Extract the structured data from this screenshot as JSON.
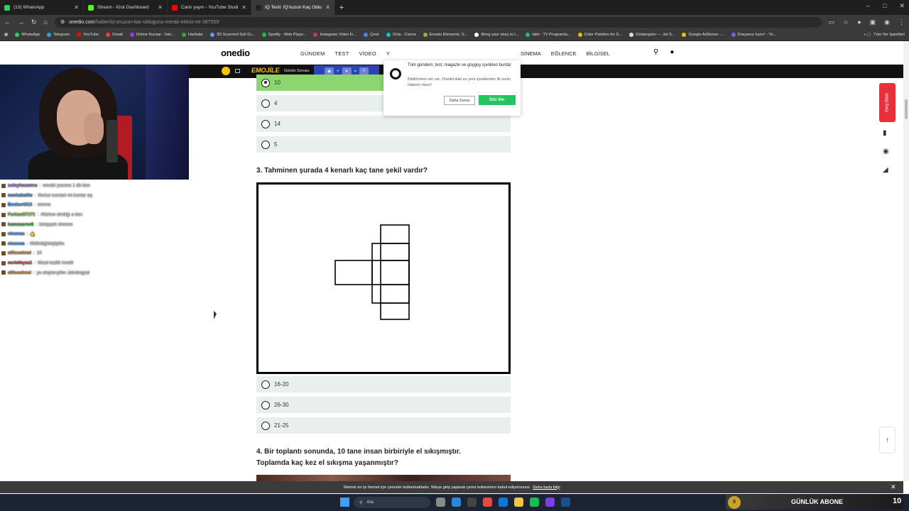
{
  "browser": {
    "tabs": [
      {
        "title": "(13) WhatsApp",
        "color": "#25d366",
        "active": false
      },
      {
        "title": "Stream - Kick Dashboard",
        "color": "#53fc18",
        "active": false
      },
      {
        "title": "Canlı yayın - YouTube Studio",
        "color": "#ff0000",
        "active": false
      },
      {
        "title": "IQ Testi: IQ'nuzun Kaç Olduğu",
        "color": "#222222",
        "active": true
      }
    ],
    "url_host": "onedio.com",
    "url_path": "/haber/iq-unuzun-kac-oldugunu-merak-ettiniz-mi-387559",
    "bookmarks": [
      {
        "label": "WhatsApp",
        "color": "#25d366"
      },
      {
        "label": "Telegram",
        "color": "#2aa4e4"
      },
      {
        "label": "YouTube",
        "color": "#ff0000"
      },
      {
        "label": "Gmail",
        "color": "#ea4335"
      },
      {
        "label": "Online Kursiar - İste...",
        "color": "#a435f0"
      },
      {
        "label": "Haritalar",
        "color": "#34a853"
      },
      {
        "label": "3D Scanned Soil Gr...",
        "color": "#5aa0ff"
      },
      {
        "label": "Spotify - Web Playe...",
        "color": "#1db954"
      },
      {
        "label": "Instagram Video İn...",
        "color": "#c13584"
      },
      {
        "label": "Çevir",
        "color": "#4285f4"
      },
      {
        "label": "Giriş - Canva",
        "color": "#00c4cc"
      },
      {
        "label": "Envato Elements: S...",
        "color": "#82b541"
      },
      {
        "label": "Bring your story to l...",
        "color": "#ffffff"
      },
      {
        "label": "tabii - TV Programla...",
        "color": "#1fb8a0"
      },
      {
        "label": "Color Palettes for D...",
        "color": "#f5b400"
      },
      {
        "label": "Göstergeler — Jet S...",
        "color": "#dddddd"
      },
      {
        "label": "Google AdSense -...",
        "color": "#fbbc04"
      },
      {
        "label": "Dosyanız hazır! - Yo...",
        "color": "#7b5cff"
      }
    ],
    "bookmarks_all": "Tüm Yer İşaretleri"
  },
  "site": {
    "logo": "onedio",
    "nav": [
      "GÜNDEM",
      "TEST",
      "VİDEO",
      "Y"
    ],
    "nav_right": [
      "SİNEMA",
      "EĞLENCE",
      "BİLGİSEL"
    ],
    "emojile": "EMOJİLE",
    "gunun_sorusu": "Günün Sorusu"
  },
  "quiz": {
    "q2_options": [
      {
        "text": "10",
        "selected": true
      },
      {
        "text": "4",
        "selected": false
      },
      {
        "text": "14",
        "selected": false
      },
      {
        "text": "5",
        "selected": false
      }
    ],
    "q3_title": "3. Tahminen şurada 4 kenarlı kaç tane şekil vardır?",
    "q3_options": [
      {
        "text": "16-20"
      },
      {
        "text": "26-30"
      },
      {
        "text": "21-25"
      }
    ],
    "q4_title_line1": "4. Bir toplantı sonunda, 10 tane insan birbiriyle el sıkışmıştır.",
    "q4_title_line2": "Toplamda kaç kez el sıkışma yaşanmıştır?"
  },
  "popup": {
    "title": "Tüm gündem, test, magazin ve goygoy içerikleri burda!",
    "body": "Bildirimlere izin ver, Onedio'daki en yeni içeriklerden ilk senin haberin olsun!",
    "later": "Daha Sonra",
    "allow": "İzin Ver"
  },
  "side": {
    "login": "Giriş Bildir"
  },
  "chat": [
    {
      "user": "zuleyhazamra",
      "msg": "cevabi yazana 1 db ban",
      "color": "#b07ce0"
    },
    {
      "user": "markakalite",
      "msg": "ilkokul sorulari mi bunlar aq",
      "color": "#5aa0ff"
    },
    {
      "user": "Bozkurt313",
      "msg": "simma",
      "color": "#5aa0ff"
    },
    {
      "user": "Furkan57171",
      "msg": "Allahım drellığı a bov",
      "color": "#8fd44a"
    },
    {
      "user": "hamzaarsvß",
      "msg": "kelepçek sheeee",
      "color": "#3ed44a"
    },
    {
      "user": "nisanaa",
      "msg": "🤙",
      "color": "#5aa0ff"
    },
    {
      "user": "nisanaa",
      "msg": "llllldkdkjjkkkjkjdks",
      "color": "#5aa0ff"
    },
    {
      "user": "ellfuseknol",
      "msg": "10",
      "color": "#e0a030"
    },
    {
      "user": "ecrinfeyza1",
      "msg": "Mizal kadlik hesilil",
      "color": "#e05050"
    },
    {
      "user": "ellfuseknol",
      "msg": "ya olaylarıyilim Jahabagad",
      "color": "#e0a030"
    }
  ],
  "cookie": {
    "text": "Sitemiz en iyi hizmet için çerezler kullanmaktadır. Siteye giriş yaparak çerez kullanımını kabul ediyorsunuz.",
    "link": "Daha fazla bilgi"
  },
  "taskbar": {
    "search": "Ara",
    "abone_label": "GÜNLÜK ABONE",
    "abone_count": "10",
    "coin": "0"
  }
}
